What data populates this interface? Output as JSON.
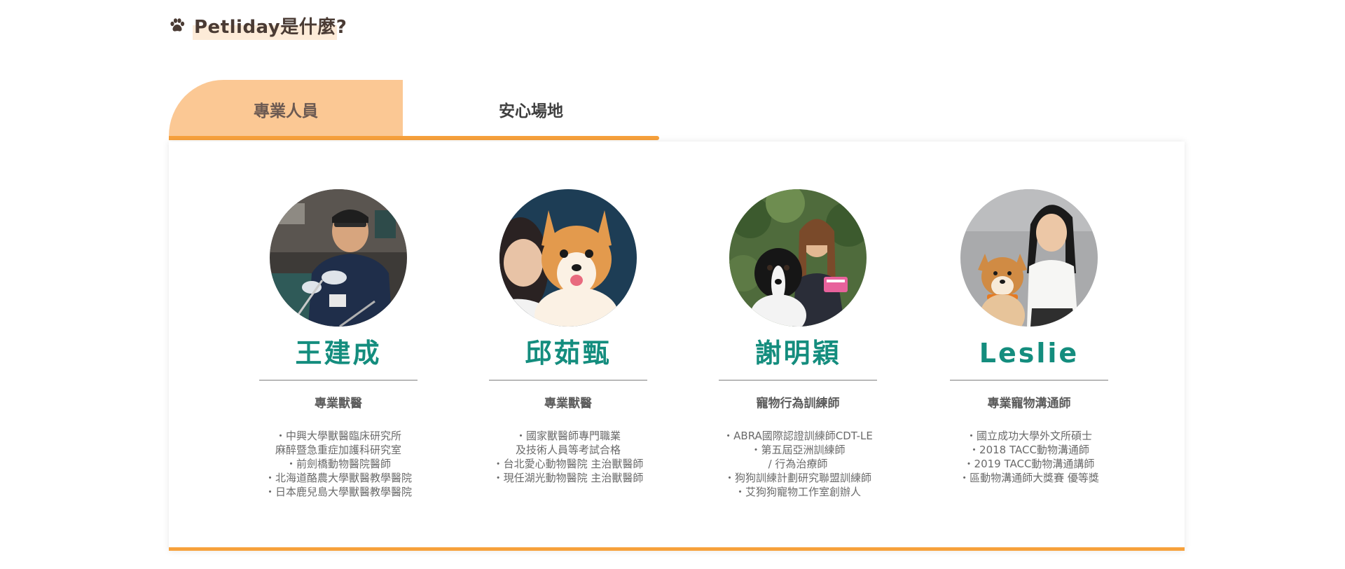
{
  "section": {
    "title": "Petliday是什麼?"
  },
  "tabs": [
    {
      "label": "專業人員",
      "active": true
    },
    {
      "label": "安心場地",
      "active": false
    }
  ],
  "colors": {
    "accent": "#f7a13c",
    "tab_active_bg": "#fbc894",
    "name_color": "#148d7e"
  },
  "team": [
    {
      "name": "王建成",
      "role": "專業獸醫",
      "bio": [
        "・中興大學獸醫臨床研究所",
        "麻醉暨急重症加護科研究室",
        "・前劍橋動物醫院醫師",
        "・北海道酪農大學獸醫教學醫院",
        "・日本鹿兒島大學獸醫教學醫院"
      ]
    },
    {
      "name": "邱茹甄",
      "role": "專業獸醫",
      "bio": [
        "・國家獸醫師專門職業",
        "及技術人員等考試合格",
        "・台北愛心動物醫院 主治獸醫師",
        "・現任湖光動物醫院 主治獸醫師"
      ]
    },
    {
      "name": "謝明穎",
      "role": "寵物行為訓練師",
      "bio": [
        "・ABRA國際認證訓練師CDT-LE",
        "・第五屆亞洲訓練師",
        "/ 行為治療師",
        "・狗狗訓練計劃研究聯盟訓練師",
        "・艾狗狗寵物工作室創辦人"
      ]
    },
    {
      "name": "Leslie",
      "role": "專業寵物溝通師",
      "bio": [
        "・國立成功大學外文所碩士",
        "・2018 TACC動物溝通師",
        "・2019 TACC動物溝通講師",
        "・區動物溝通師大獎賽 優等獎"
      ]
    }
  ]
}
